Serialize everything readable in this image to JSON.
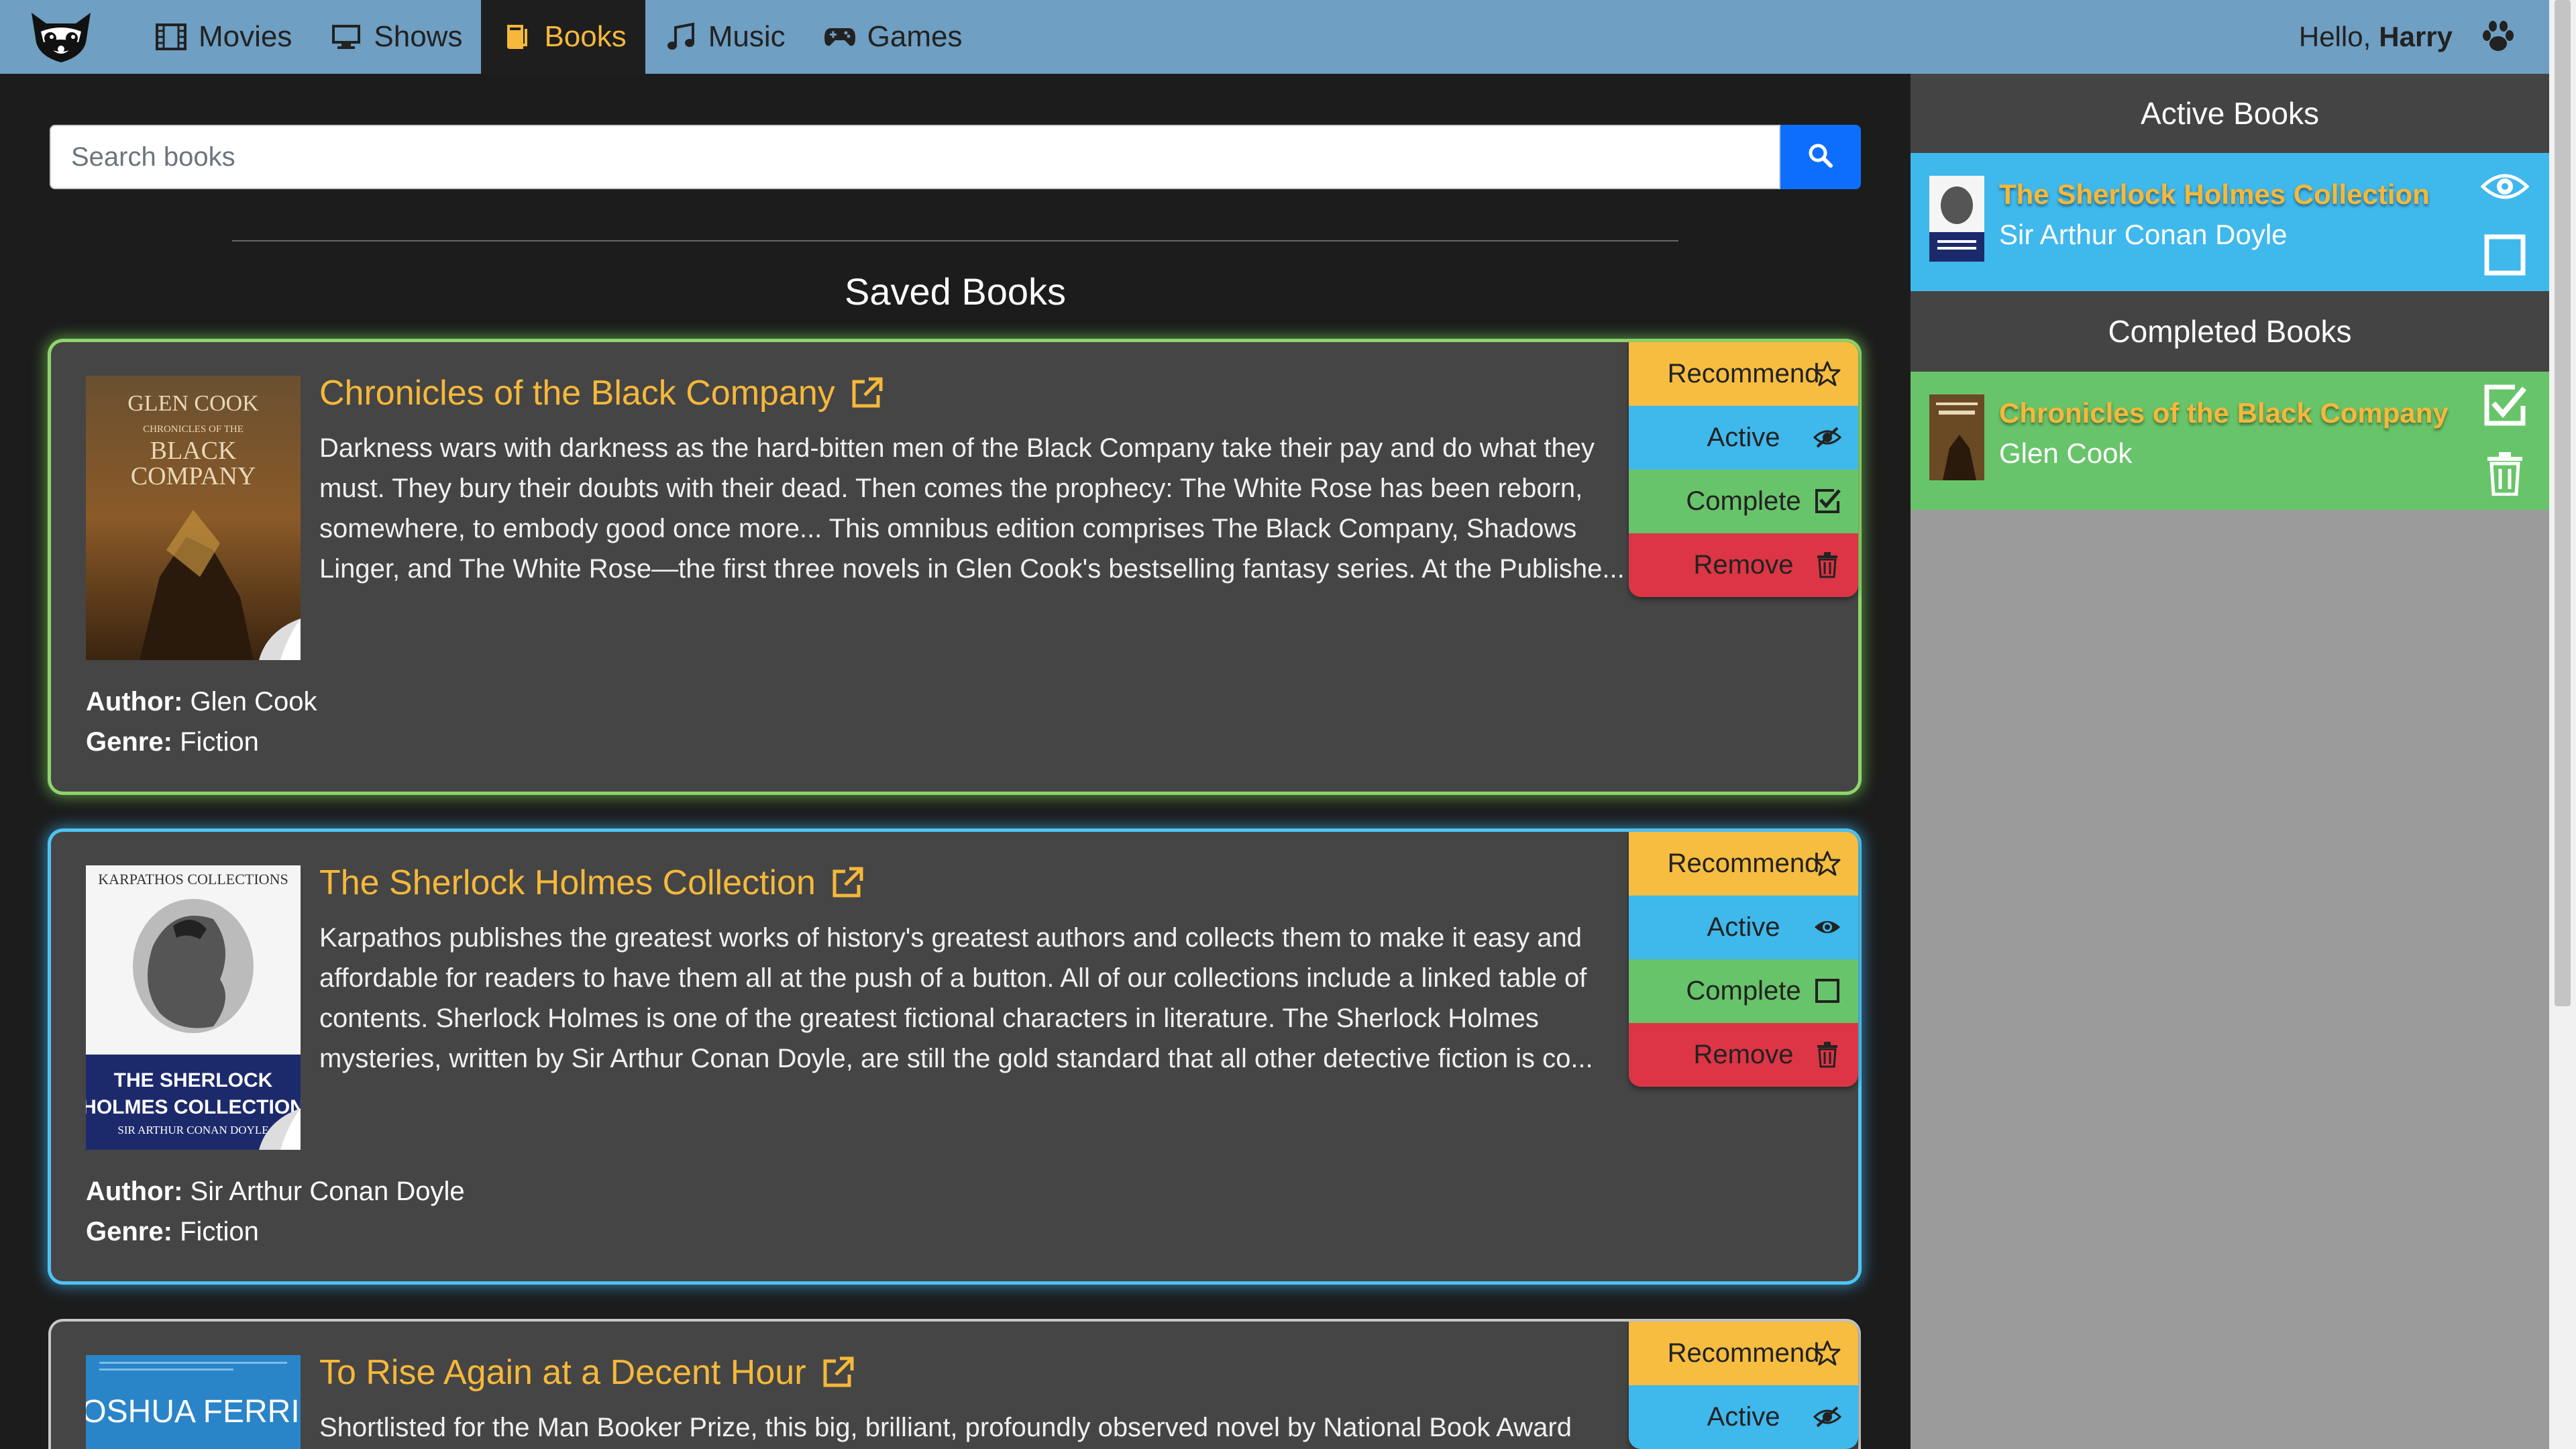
{
  "nav": {
    "items": [
      {
        "label": "Movies",
        "icon": "film-icon"
      },
      {
        "label": "Shows",
        "icon": "tv-icon"
      },
      {
        "label": "Books",
        "icon": "book-icon"
      },
      {
        "label": "Music",
        "icon": "music-icon"
      },
      {
        "label": "Games",
        "icon": "gamepad-icon"
      }
    ],
    "active": "Books",
    "greeting": "Hello,",
    "user": "Harry"
  },
  "search": {
    "placeholder": "Search books"
  },
  "main": {
    "heading": "Saved Books"
  },
  "labels": {
    "author": "Author:",
    "genre": "Genre:",
    "recommend": "Recommend",
    "active": "Active",
    "complete": "Complete",
    "remove": "Remove"
  },
  "books": [
    {
      "title": "Chronicles of the Black Company",
      "description": "Darkness wars with darkness as the hard-bitten men of the Black Company take their pay and do what they must. They bury their doubts with their dead. Then comes the prophecy: The White Rose has been reborn, somewhere, to embody good once more... This omnibus edition comprises The Black Company, Shadows Linger, and The White Rose—the first three novels in Glen Cook's bestselling fantasy series. At the Publishe...",
      "author": "Glen Cook",
      "genre": "Fiction",
      "cover_text": [
        "GLEN COOK",
        "CHRONICLES OF THE",
        "BLACK",
        "COMPANY"
      ],
      "status": "completed"
    },
    {
      "title": "The Sherlock Holmes Collection",
      "description": "Karpathos publishes the greatest works of history's greatest authors and collects them to make it easy and affordable for readers to have them all at the push of a button. All of our collections include a linked table of contents. Sherlock Holmes is one of the greatest fictional characters in literature. The Sherlock Holmes mysteries, written by Sir Arthur Conan Doyle, are still the gold standard that all other detective fiction is co...",
      "author": "Sir Arthur Conan Doyle",
      "genre": "Fiction",
      "cover_text": [
        "KARPATHOS COLLECTIONS",
        "THE SHERLOCK",
        "HOLMES COLLECTION",
        "SIR ARTHUR CONAN DOYLE"
      ],
      "status": "active"
    },
    {
      "title": "To Rise Again at a Decent Hour",
      "description": "Shortlisted for the Man Booker Prize, this big, brilliant, profoundly observed novel by National Book Award",
      "cover_text": [
        "JOSHUA FERRIS"
      ],
      "status": "saved"
    }
  ],
  "sidebar": {
    "active_heading": "Active Books",
    "active_item": {
      "title": "The Sherlock Holmes Collection",
      "author": "Sir Arthur Conan Doyle"
    },
    "completed_heading": "Completed Books",
    "completed_item": {
      "title": "Chronicles of the Black Company",
      "author": "Glen Cook"
    }
  },
  "colors": {
    "navbar": "#6f9fc2",
    "accent": "#f6b83a",
    "active_blue": "#3fb8ec",
    "complete_green": "#68c46a",
    "remove_red": "#dc3545",
    "recommend_yellow": "#f6bd40"
  }
}
